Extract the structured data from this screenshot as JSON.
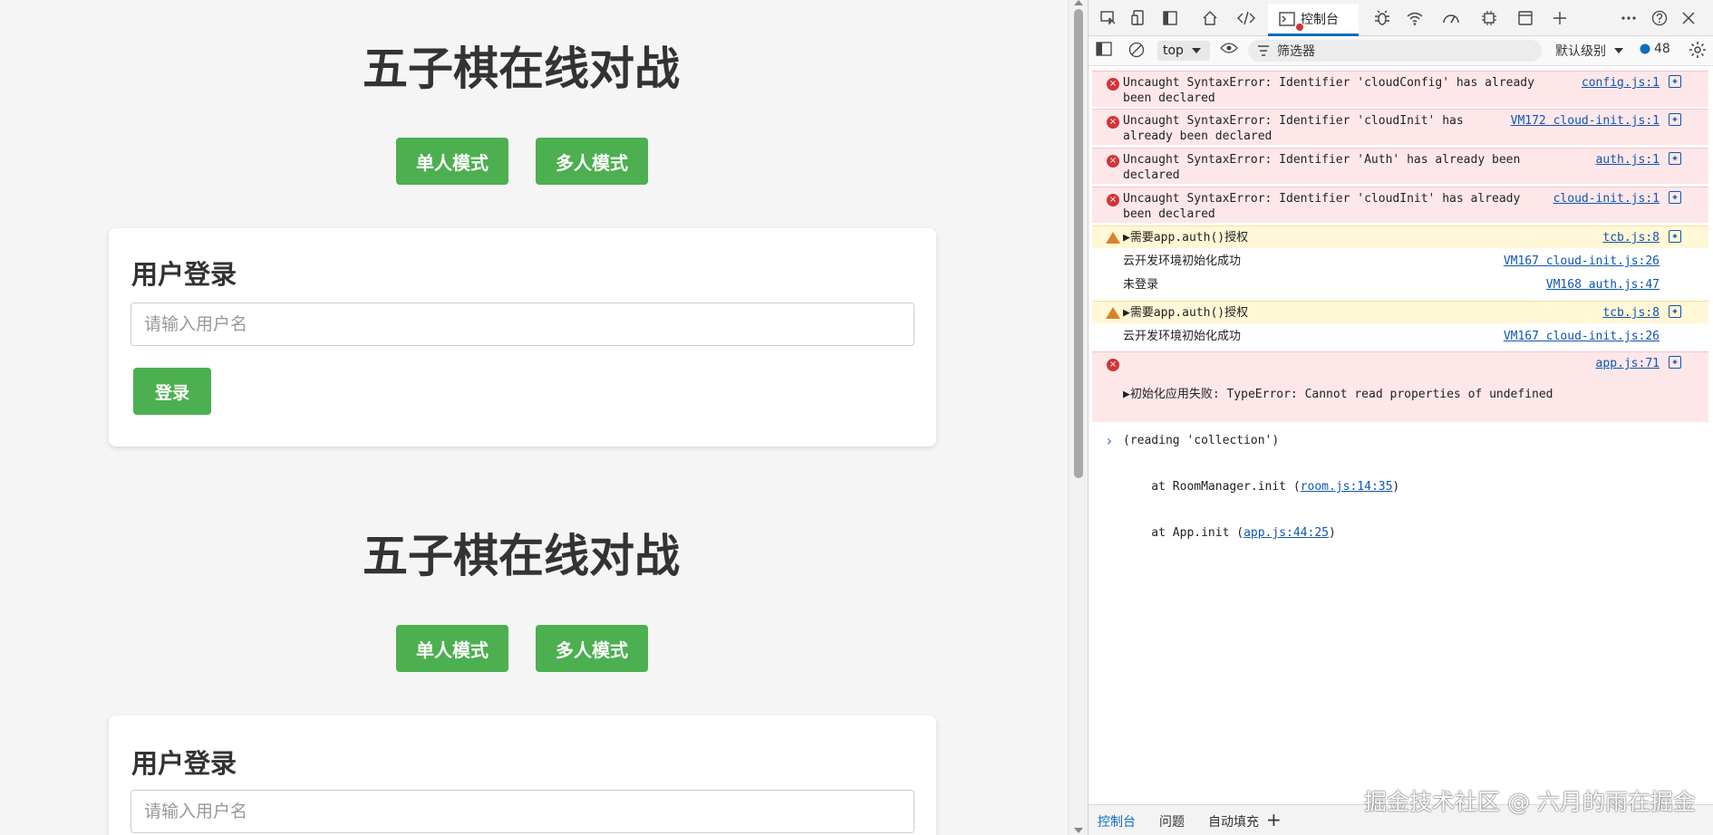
{
  "page": {
    "sections": [
      {
        "title": "五子棋在线对战",
        "single_mode": "单人模式",
        "multi_mode": "多人模式",
        "login_title": "用户登录",
        "username_placeholder": "请输入用户名",
        "login_button": "登录"
      },
      {
        "title": "五子棋在线对战",
        "single_mode": "单人模式",
        "multi_mode": "多人模式",
        "login_title": "用户登录",
        "username_placeholder": "请输入用户名"
      }
    ],
    "accent_color": "#4caf50"
  },
  "devtools": {
    "tabs": {
      "console_label": "控制台"
    },
    "filter_bar": {
      "context": "top",
      "filter_placeholder": "筛选器",
      "level": "默认级别",
      "issues_count": "48"
    },
    "messages": [
      {
        "type": "error",
        "text": "Uncaught SyntaxError: Identifier 'cloudConfig' has already\nbeen declared",
        "source": "config.js:1"
      },
      {
        "type": "error",
        "text": "Uncaught SyntaxError: Identifier 'cloudInit' has\nalready been declared",
        "source": "VM172 cloud-init.js:1"
      },
      {
        "type": "error",
        "text": "Uncaught SyntaxError: Identifier 'Auth' has already been\ndeclared",
        "source": "auth.js:1"
      },
      {
        "type": "error",
        "text": "Uncaught SyntaxError: Identifier 'cloudInit' has already\nbeen declared",
        "source": "cloud-init.js:1"
      },
      {
        "type": "warn",
        "text": "▶需要app.auth()授权",
        "source": "tcb.js:8"
      },
      {
        "type": "log",
        "text": "云开发环境初始化成功",
        "source": "VM167 cloud-init.js:26"
      },
      {
        "type": "log",
        "text": "未登录",
        "source": "VM168 auth.js:47"
      },
      {
        "type": "warn",
        "text": "▶需要app.auth()授权",
        "source": "tcb.js:8"
      },
      {
        "type": "log",
        "text": "云开发环境初始化成功",
        "source": "VM167 cloud-init.js:26"
      }
    ],
    "last_error": {
      "line1": "▶初始化应用失败: TypeError: Cannot read properties of undefined",
      "line2": "(reading 'collection')",
      "line3_prefix": "    at RoomManager.init (",
      "line3_link": "room.js:14:35",
      "line3_suffix": ")",
      "line4_prefix": "    at App.init (",
      "line4_link": "app.js:44:25",
      "line4_suffix": ")",
      "source": "app.js:71"
    },
    "bottom_tabs": [
      "控制台",
      "问题",
      "自动填充"
    ],
    "watermark": "掘金技术社区 @ 六月的雨在掘金"
  }
}
